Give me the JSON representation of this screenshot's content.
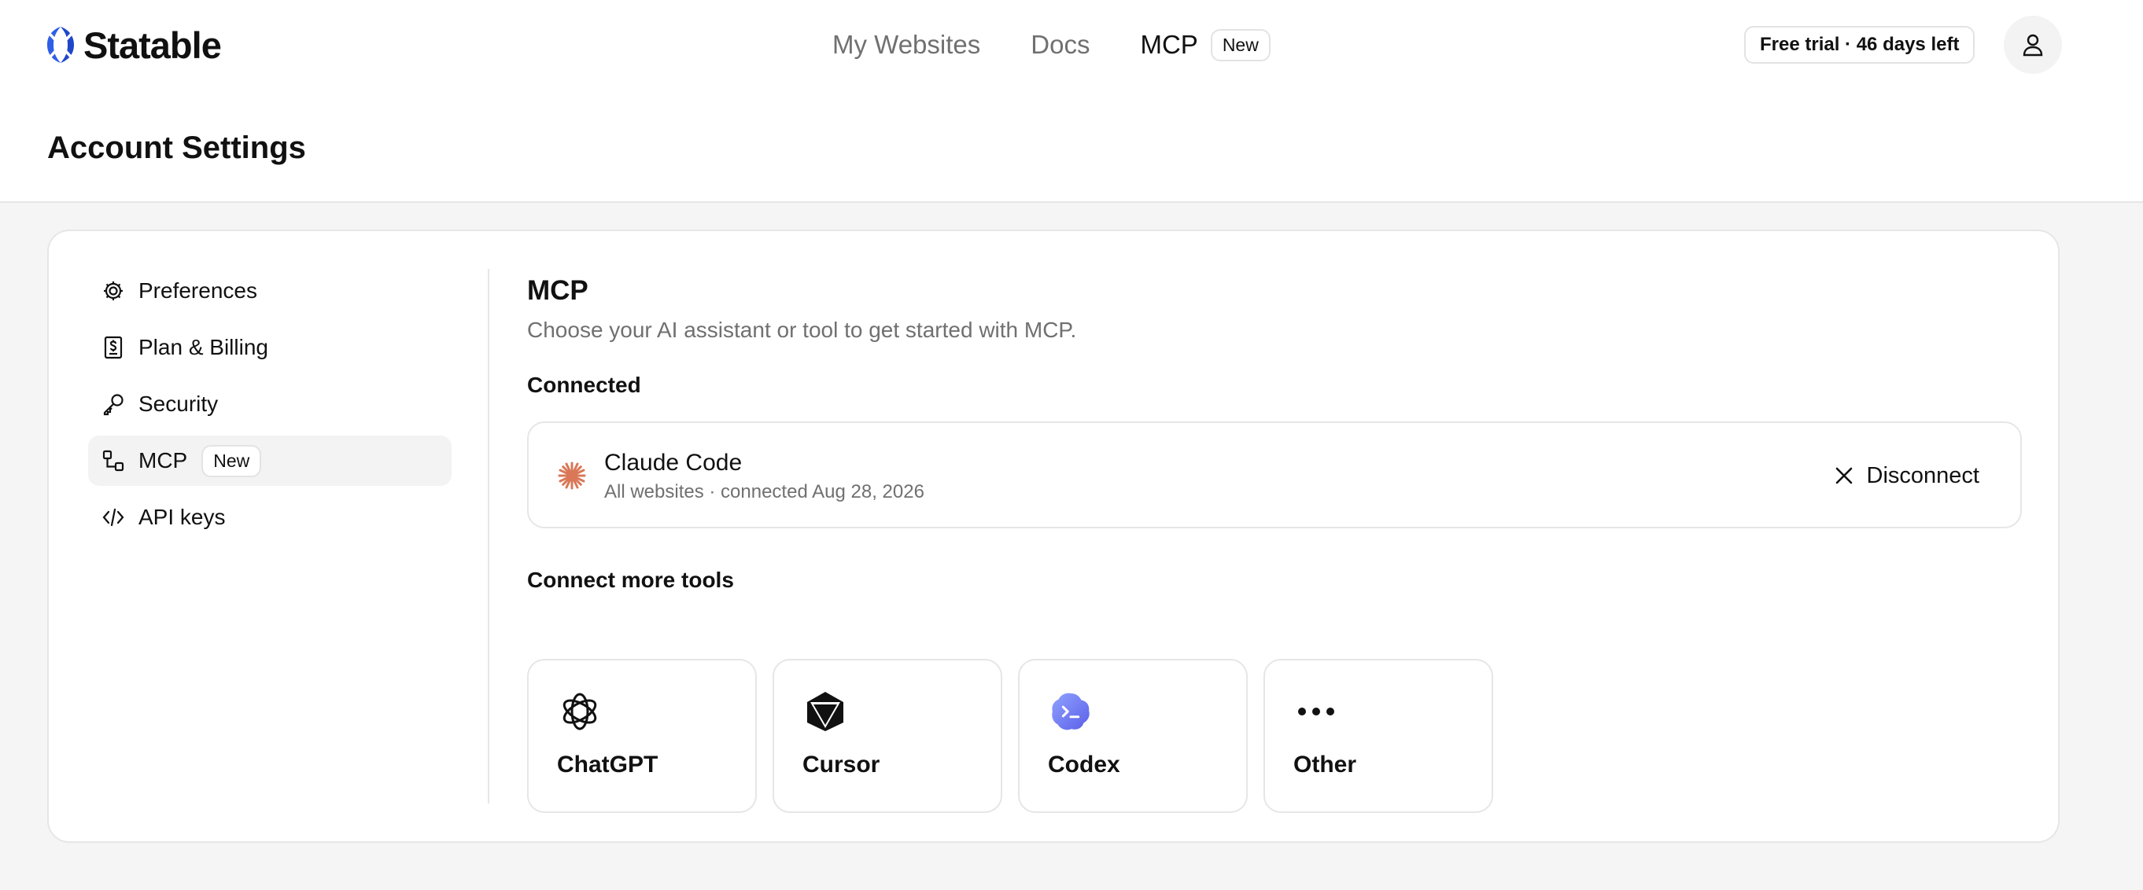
{
  "app": {
    "name": "Statable"
  },
  "nav": {
    "my_websites": "My Websites",
    "docs": "Docs",
    "mcp": "MCP",
    "mcp_badge": "New"
  },
  "trial": {
    "label": "Free trial · 46 days left"
  },
  "user": {
    "avatar_icon": "user-icon"
  },
  "page": {
    "title": "Account Settings"
  },
  "sidebar": {
    "items": [
      {
        "label": "Preferences",
        "icon": "gear-icon"
      },
      {
        "label": "Plan & Billing",
        "icon": "billing-icon"
      },
      {
        "label": "Security",
        "icon": "key-icon"
      },
      {
        "label": "MCP",
        "icon": "mcp-icon",
        "badge": "New",
        "selected": true
      },
      {
        "label": "API keys",
        "icon": "code-icon"
      }
    ]
  },
  "main": {
    "title": "MCP",
    "subtitle": "Choose your AI assistant or tool to get started with MCP.",
    "connected_title": "Connected",
    "connected": {
      "name": "Claude Code",
      "meta": "All websites · connected Aug 28, 2026",
      "disconnect_label": "Disconnect"
    },
    "more_title": "Connect more tools",
    "tools": [
      {
        "label": "ChatGPT",
        "icon": "chatgpt-icon"
      },
      {
        "label": "Cursor",
        "icon": "cursor-icon"
      },
      {
        "label": "Codex",
        "icon": "codex-icon"
      },
      {
        "label": "Other",
        "icon": "more-icon"
      }
    ]
  },
  "colors": {
    "brand": "#2f5fe6",
    "claude": "#d97757",
    "codex": "#6f7cf5"
  }
}
